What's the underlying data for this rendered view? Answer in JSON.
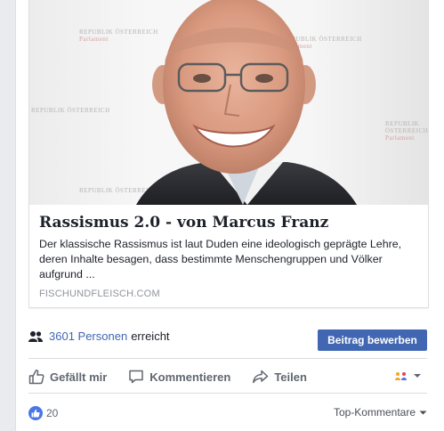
{
  "link_preview": {
    "title": "Rassismus 2.0 - von Marcus Franz",
    "description": "Der klassische Rassismus ist laut Duden eine ideologisch geprägte Lehre, deren Inhalte besagen, dass bestimmte Menschengruppen und Völker aufgrund ...",
    "domain": "FISCHUNDFLEISCH.COM",
    "image_watermarks": [
      "REPUBLIK ÖSTERREICH",
      "Parlament"
    ]
  },
  "reach": {
    "count_label": "3601 Personen",
    "suffix": "erreicht",
    "boost_button": "Beitrag bewerben"
  },
  "actions": {
    "like": "Gefällt mir",
    "comment": "Kommentieren",
    "share": "Teilen"
  },
  "footer": {
    "like_count": "20",
    "sort_label": "Top-Kommentare"
  },
  "colors": {
    "accent": "#4267b2",
    "like_blue": "#4a76e8",
    "muted": "#606770"
  }
}
